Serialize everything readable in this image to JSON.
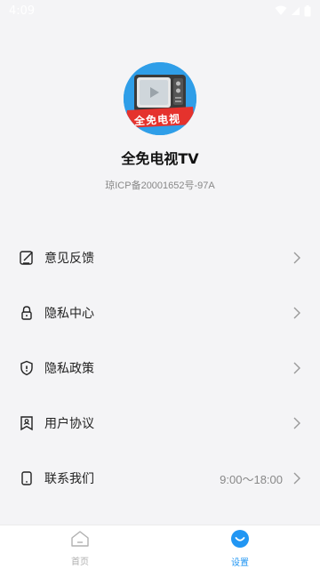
{
  "status_bar": {
    "time": "4:09",
    "icons": [
      "wifi-icon",
      "signal-icon",
      "battery-icon"
    ]
  },
  "header": {
    "logo_text": "全免电视",
    "app_name": "全免电视TV",
    "icp": "琼ICP备20001652号-97A"
  },
  "menu": {
    "items": [
      {
        "label": "意见反馈",
        "icon": "feedback-icon"
      },
      {
        "label": "隐私中心",
        "icon": "lock-icon"
      },
      {
        "label": "隐私政策",
        "icon": "shield-icon"
      },
      {
        "label": "用户协议",
        "icon": "bookmark-user-icon"
      },
      {
        "label": "联系我们",
        "icon": "phone-icon",
        "value": "9:00～18:00"
      }
    ]
  },
  "tabbar": {
    "tabs": [
      {
        "label": "首页",
        "icon": "home-icon",
        "active": false
      },
      {
        "label": "设置",
        "icon": "smile-icon",
        "active": true
      }
    ],
    "active_color": "#2196f3",
    "inactive_color": "#b0b0b0"
  }
}
